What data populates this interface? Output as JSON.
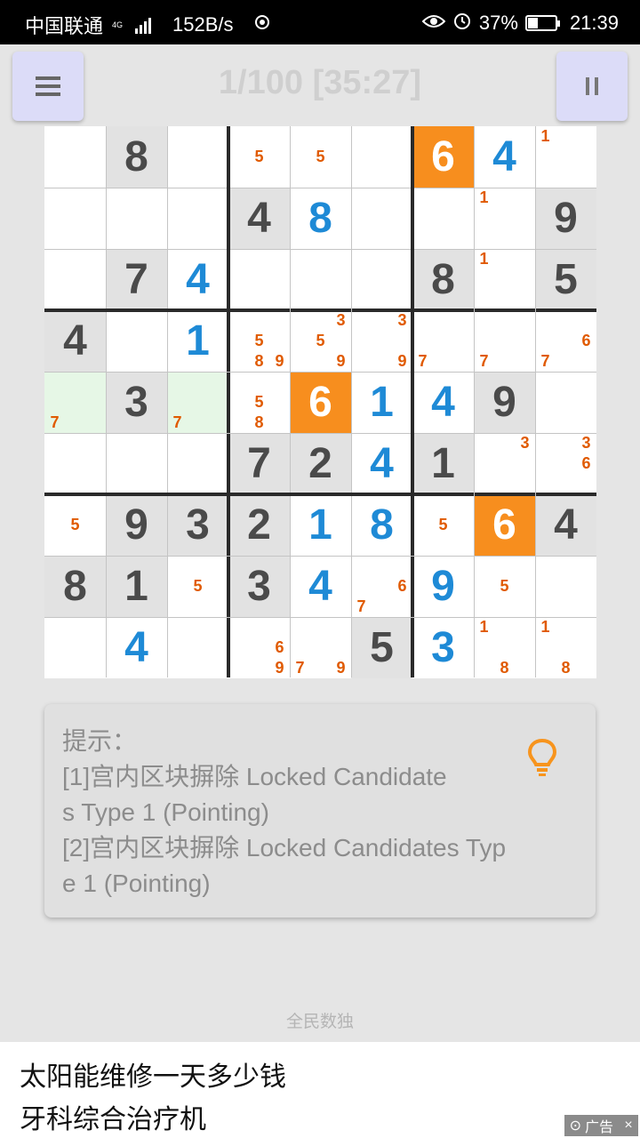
{
  "status_bar": {
    "carrier": "中国联通",
    "network_type": "4G",
    "speed": "152B/s",
    "battery_percent": "37%",
    "time": "21:39",
    "battery_level": 0.37,
    "icons": [
      "signal-icon",
      "sync-icon",
      "eye-icon",
      "alarm-icon",
      "battery-icon"
    ]
  },
  "header": {
    "title": "1/100 [35:27]",
    "menu_icon": "menu-icon",
    "pause_icon": "pause-icon"
  },
  "colors": {
    "given": "#4a4a4a",
    "user": "#1e8ad6",
    "candidate": "#e05a00",
    "highlight": "#f78e1e",
    "hint_cell": "#e6f7e6",
    "button": "#dcdcf8"
  },
  "board": {
    "cells": [
      [
        {
          "candidates": []
        },
        {
          "v": "8",
          "t": "given"
        },
        {
          "candidates": []
        },
        {
          "candidates": [
            "5"
          ]
        },
        {
          "candidates": [
            "5"
          ]
        },
        {
          "candidates": []
        },
        {
          "v": "6",
          "t": "highlight"
        },
        {
          "v": "4",
          "t": "user"
        },
        {
          "candidates": [
            "1"
          ]
        }
      ],
      [
        {
          "candidates": []
        },
        {
          "candidates": []
        },
        {
          "candidates": []
        },
        {
          "v": "4",
          "t": "given"
        },
        {
          "v": "8",
          "t": "user"
        },
        {
          "candidates": []
        },
        {
          "candidates": []
        },
        {
          "candidates": [
            "1"
          ]
        },
        {
          "v": "9",
          "t": "given"
        }
      ],
      [
        {
          "candidates": []
        },
        {
          "v": "7",
          "t": "given"
        },
        {
          "v": "4",
          "t": "user"
        },
        {
          "candidates": []
        },
        {
          "candidates": []
        },
        {
          "candidates": []
        },
        {
          "v": "8",
          "t": "given"
        },
        {
          "candidates": [
            "1"
          ]
        },
        {
          "v": "5",
          "t": "given"
        }
      ],
      [
        {
          "v": "4",
          "t": "given"
        },
        {
          "candidates": []
        },
        {
          "v": "1",
          "t": "user"
        },
        {
          "candidates": [
            "5",
            "8",
            "9"
          ]
        },
        {
          "candidates": [
            "3",
            "5",
            "9"
          ]
        },
        {
          "candidates": [
            "3",
            "9"
          ]
        },
        {
          "candidates": [
            "7"
          ]
        },
        {
          "candidates": [
            "7"
          ]
        },
        {
          "candidates": [
            "6",
            "7"
          ]
        }
      ],
      [
        {
          "candidates": [
            "7"
          ],
          "green": true
        },
        {
          "v": "3",
          "t": "given"
        },
        {
          "candidates": [
            "7"
          ],
          "green": true
        },
        {
          "candidates": [
            "5",
            "8"
          ]
        },
        {
          "v": "6",
          "t": "highlight"
        },
        {
          "v": "1",
          "t": "user"
        },
        {
          "v": "4",
          "t": "user"
        },
        {
          "v": "9",
          "t": "given"
        },
        {
          "candidates": []
        }
      ],
      [
        {
          "candidates": []
        },
        {
          "candidates": []
        },
        {
          "candidates": []
        },
        {
          "v": "7",
          "t": "given"
        },
        {
          "v": "2",
          "t": "given"
        },
        {
          "v": "4",
          "t": "user"
        },
        {
          "v": "1",
          "t": "given"
        },
        {
          "candidates": [
            "3"
          ]
        },
        {
          "candidates": [
            "3",
            "6"
          ]
        }
      ],
      [
        {
          "candidates": [
            "5"
          ]
        },
        {
          "v": "9",
          "t": "given"
        },
        {
          "v": "3",
          "t": "given"
        },
        {
          "v": "2",
          "t": "given"
        },
        {
          "v": "1",
          "t": "user"
        },
        {
          "v": "8",
          "t": "user"
        },
        {
          "candidates": [
            "5"
          ]
        },
        {
          "v": "6",
          "t": "highlight"
        },
        {
          "v": "4",
          "t": "given"
        }
      ],
      [
        {
          "v": "8",
          "t": "given"
        },
        {
          "v": "1",
          "t": "given"
        },
        {
          "candidates": [
            "5"
          ]
        },
        {
          "v": "3",
          "t": "given"
        },
        {
          "v": "4",
          "t": "user"
        },
        {
          "candidates": [
            "6",
            "7"
          ]
        },
        {
          "v": "9",
          "t": "user"
        },
        {
          "candidates": [
            "5"
          ]
        },
        {
          "candidates": []
        }
      ],
      [
        {
          "candidates": []
        },
        {
          "v": "4",
          "t": "user"
        },
        {
          "candidates": []
        },
        {
          "candidates": [
            "6",
            "9"
          ]
        },
        {
          "candidates": [
            "7",
            "9"
          ]
        },
        {
          "v": "5",
          "t": "given"
        },
        {
          "v": "3",
          "t": "user"
        },
        {
          "candidates": [
            "1",
            "8"
          ]
        },
        {
          "candidates": [
            "1",
            "8"
          ]
        }
      ]
    ]
  },
  "hint": {
    "lines": [
      "提示：",
      "[1]宫内区块摒除 Locked Candidate",
      "s Type 1 (Pointing)",
      "[2]宫内区块摒除 Locked Candidates Typ",
      "e 1 (Pointing)"
    ],
    "icon": "lightbulb-icon"
  },
  "footer": {
    "app_name": "全民数独"
  },
  "ad": {
    "line1": "太阳能维修一天多少钱",
    "line2": "牙科综合治疗机",
    "tag": "广告",
    "close": "×"
  }
}
